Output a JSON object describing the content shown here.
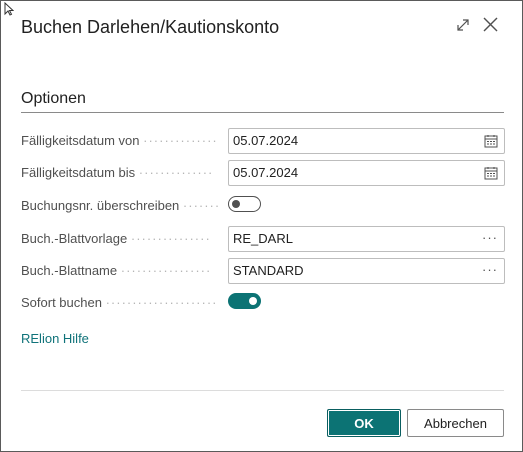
{
  "dialog": {
    "title": "Buchen Darlehen/Kautionskonto"
  },
  "section": {
    "title": "Optionen"
  },
  "fields": {
    "faellig_von": {
      "label": "Fälligkeitsdatum von",
      "value": "05.07.2024"
    },
    "faellig_bis": {
      "label": "Fälligkeitsdatum bis",
      "value": "05.07.2024"
    },
    "buchungsnr": {
      "label": "Buchungsnr. überschreiben",
      "state": "off"
    },
    "blattvorlage": {
      "label": "Buch.-Blattvorlage",
      "value": "RE_DARL"
    },
    "blattname": {
      "label": "Buch.-Blattname",
      "value": "STANDARD"
    },
    "sofort": {
      "label": "Sofort buchen",
      "state": "on"
    }
  },
  "help_link": "RElion Hilfe",
  "buttons": {
    "ok": "OK",
    "cancel": "Abbrechen"
  },
  "colors": {
    "accent": "#0c7374",
    "link": "#10737a"
  },
  "icons": [
    "expand-icon",
    "close-icon",
    "calendar-icon",
    "ellipsis-icon",
    "cursor-icon"
  ]
}
